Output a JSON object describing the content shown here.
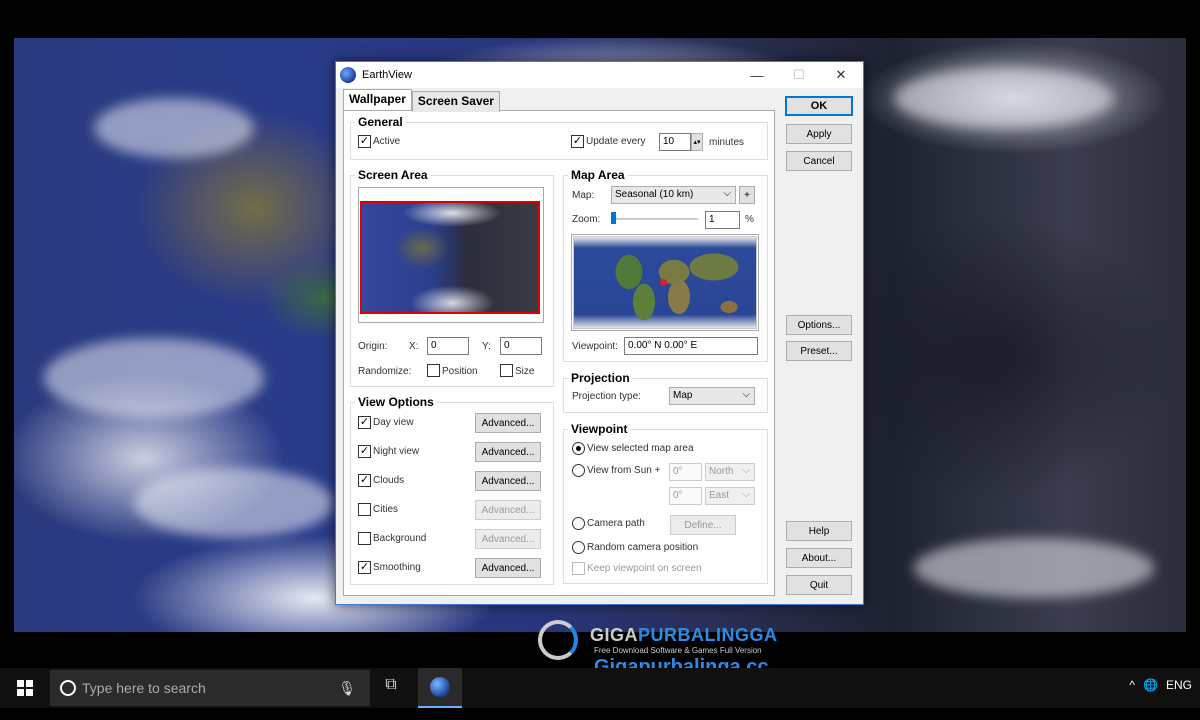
{
  "window": {
    "title": "EarthView",
    "minimize": "—",
    "maximize": "☐",
    "close": "✕"
  },
  "tabs": [
    "Wallpaper",
    "Screen Saver"
  ],
  "general": {
    "title": "General",
    "active_label": "Active",
    "active_checked": true,
    "update_label": "Update every",
    "update_checked": true,
    "update_value": "10",
    "minutes_label": "minutes"
  },
  "screen_area": {
    "title": "Screen Area",
    "origin_label": "Origin:",
    "x_label": "X:",
    "x_value": "0",
    "y_label": "Y:",
    "y_value": "0",
    "randomize_label": "Randomize:",
    "position_label": "Position",
    "size_label": "Size"
  },
  "map_area": {
    "title": "Map Area",
    "map_label": "Map:",
    "map_value": "Seasonal (10 km)",
    "plus_label": "+",
    "zoom_label": "Zoom:",
    "zoom_value": "1",
    "zoom_unit": "%",
    "viewpoint_label": "Viewpoint:",
    "viewpoint_value": "0.00° N   0.00° E"
  },
  "view_options": {
    "title": "View Options",
    "advanced_label": "Advanced...",
    "items": [
      {
        "label": "Day view",
        "checked": true,
        "enabled": true
      },
      {
        "label": "Night view",
        "checked": true,
        "enabled": true
      },
      {
        "label": "Clouds",
        "checked": true,
        "enabled": true
      },
      {
        "label": "Cities",
        "checked": false,
        "enabled": false
      },
      {
        "label": "Background",
        "checked": false,
        "enabled": false
      },
      {
        "label": "Smoothing",
        "checked": true,
        "enabled": true
      }
    ]
  },
  "projection": {
    "title": "Projection",
    "type_label": "Projection type:",
    "type_value": "Map"
  },
  "viewpoint": {
    "title": "Viewpoint",
    "selected_label": "View selected map area",
    "sun_label": "View from Sun +",
    "sun_deg1": "0°",
    "sun_dir1": "North",
    "sun_deg2": "0°",
    "sun_dir2": "East",
    "camera_label": "Camera path",
    "define_label": "Define...",
    "random_label": "Random camera position",
    "keep_label": "Keep viewpoint on screen"
  },
  "side_buttons": {
    "ok": "OK",
    "apply": "Apply",
    "cancel": "Cancel",
    "options": "Options...",
    "preset": "Preset...",
    "help": "Help",
    "about": "About...",
    "quit": "Quit"
  },
  "taskbar": {
    "search_placeholder": "Type here to search",
    "lang": "ENG"
  },
  "watermark": {
    "brand_a": "GIGA",
    "brand_b": "PURBALINGGA",
    "tagline": "Free Download Software & Games Full Version",
    "url": "Gigapurbalinga.cc"
  }
}
